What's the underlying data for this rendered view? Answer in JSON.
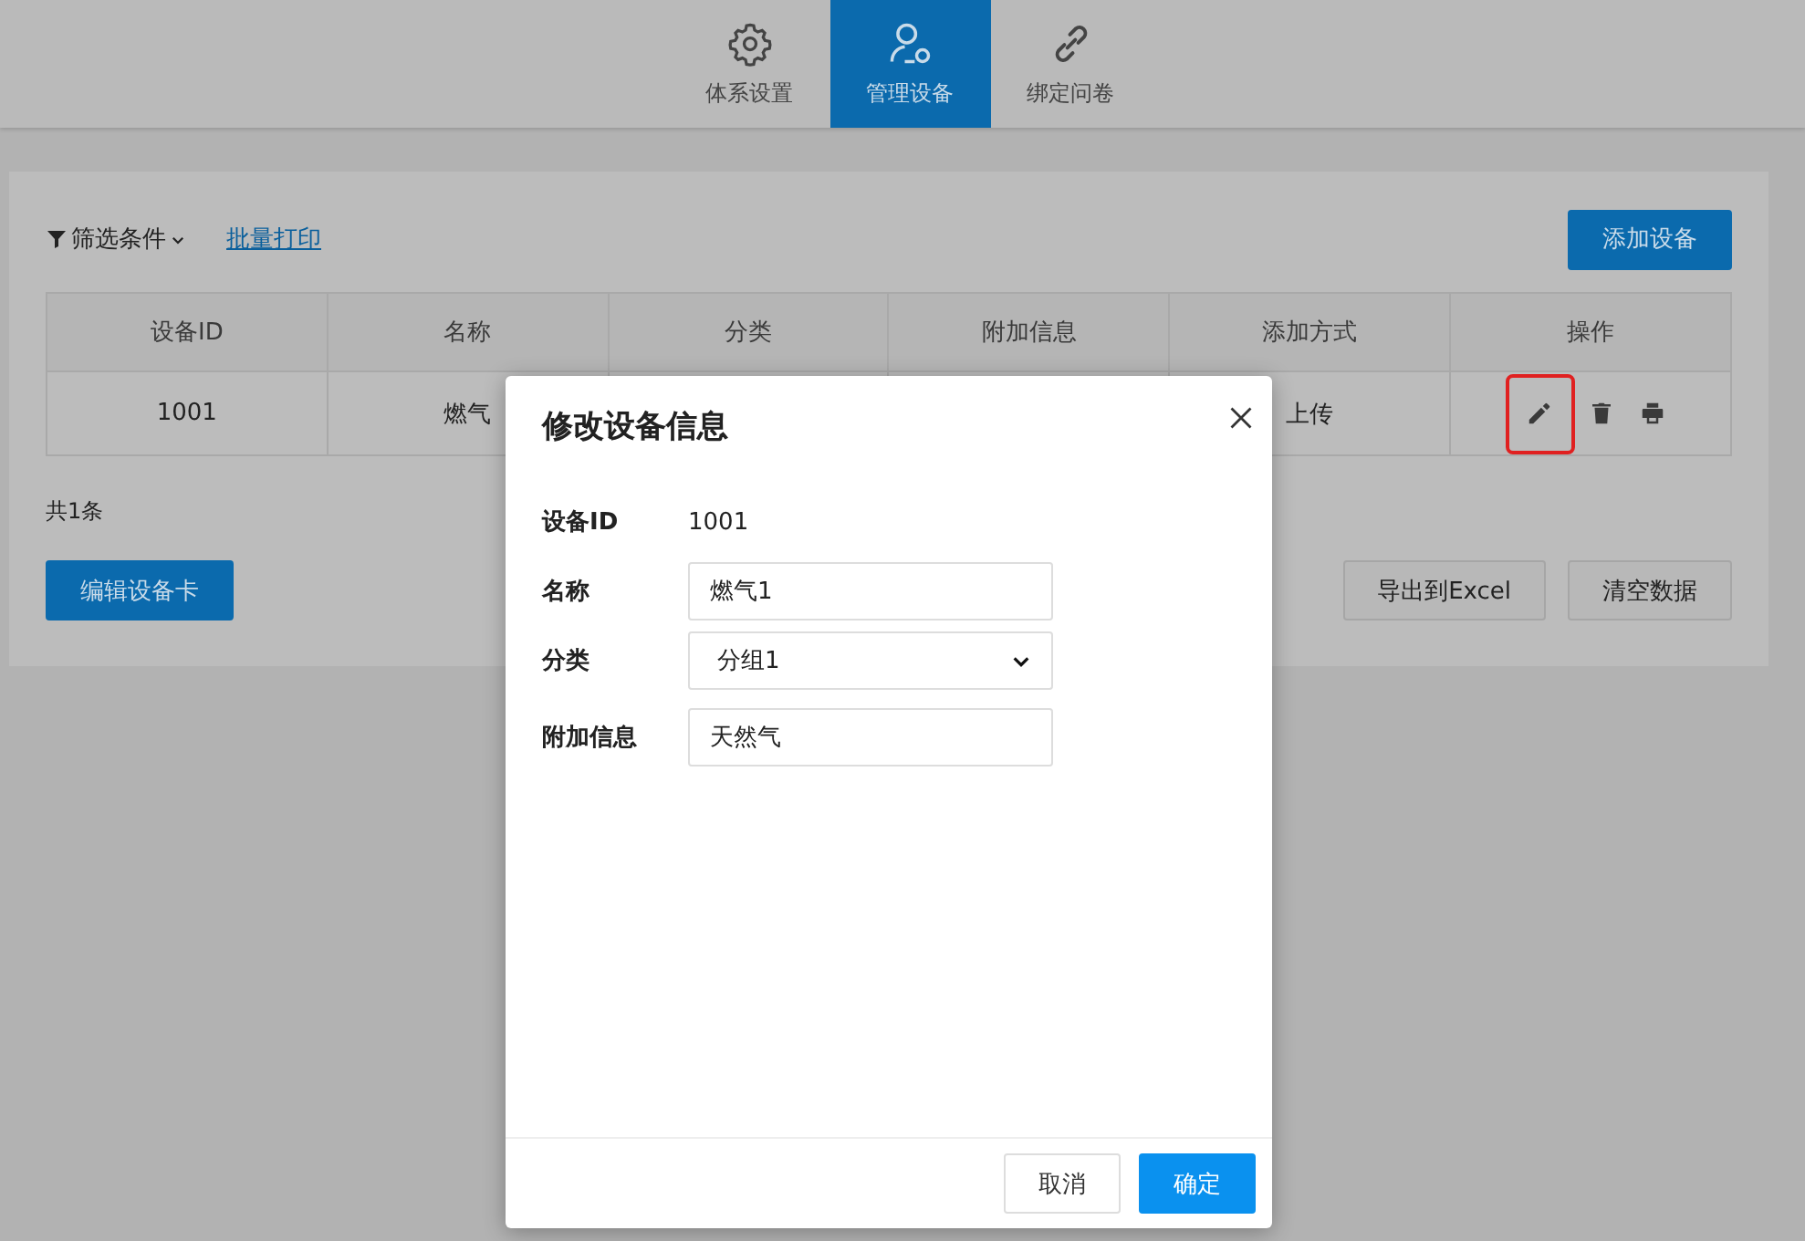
{
  "nav_tabs": [
    {
      "label": "体系设置",
      "kind": "settings",
      "selected": false
    },
    {
      "label": "管理设备",
      "kind": "devices",
      "selected": true
    },
    {
      "label": "绑定问卷",
      "kind": "binding",
      "selected": false
    }
  ],
  "toolbar": {
    "filter": "筛选条件",
    "batch_print": "批量打印",
    "add_button": "添加设备"
  },
  "table": {
    "columns": [
      "设备ID",
      "名称",
      "分类",
      "附加信息",
      "添加方式",
      "操作"
    ],
    "rows": [
      {
        "cells": [
          "1001",
          "燃气",
          "",
          "",
          "上传"
        ],
        "actions": [
          {
            "kind": "edit",
            "highlighted": true
          },
          {
            "kind": "delete",
            "highlighted": false
          },
          {
            "kind": "print",
            "highlighted": false
          }
        ]
      }
    ]
  },
  "total": "共1条",
  "left_buttons": [
    "编辑设备卡"
  ],
  "right_buttons": [
    "导出到Excel",
    "清空数据"
  ],
  "dialog": {
    "title": "修改设备信息",
    "fields": [
      {
        "label": "设备ID",
        "kind": "text",
        "value": "1001"
      },
      {
        "label": "名称",
        "kind": "input",
        "value": "燃气1"
      },
      {
        "label": "分类",
        "kind": "select",
        "value": "分组1"
      },
      {
        "label": "附加信息",
        "kind": "input",
        "value": "天然气"
      }
    ],
    "buttons": [
      {
        "label": "取消",
        "primary": false
      },
      {
        "label": "确定",
        "primary": true
      }
    ]
  }
}
